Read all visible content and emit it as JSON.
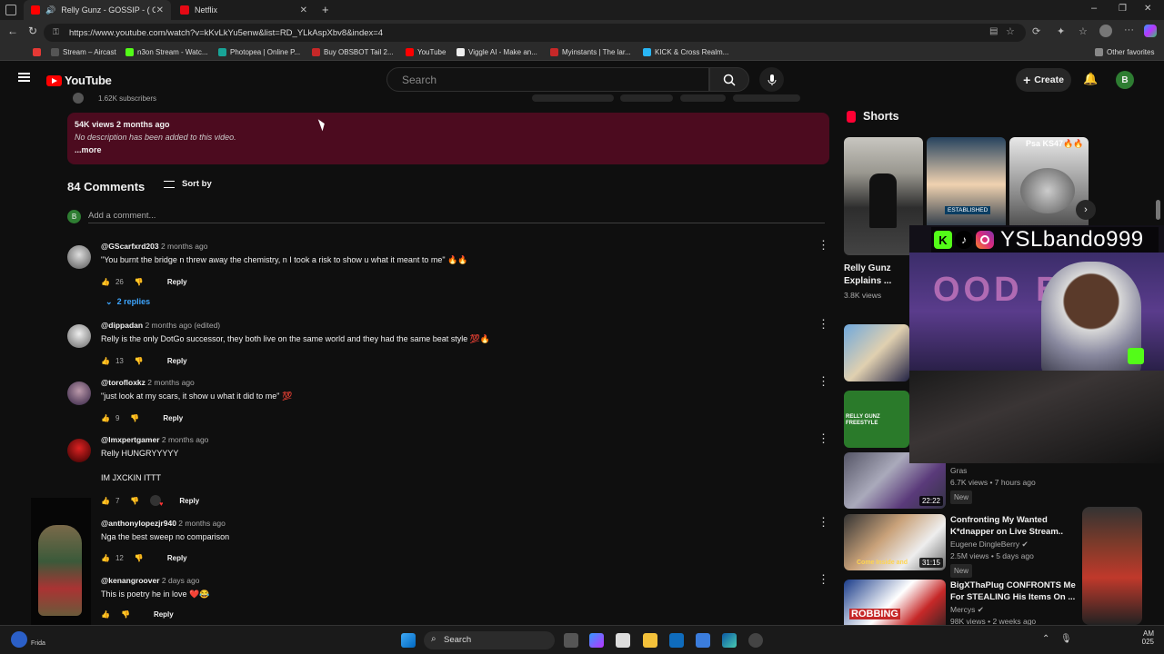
{
  "browser": {
    "tabs": [
      {
        "title": "Relly Gunz - GOSSIP - ( Offic"
      },
      {
        "title": "Netflix"
      }
    ],
    "url": "https://www.youtube.com/watch?v=kKvLkYu5enw&list=RD_YLkAspXbv8&index=4",
    "bookmarks": [
      "Stream – Aircast",
      "n3on Stream - Watc...",
      "Photopea | Online P...",
      "Buy OBSBOT Tail 2...",
      "YouTube",
      "Viggle AI - Make an...",
      "Myinstants | The lar...",
      "KICK & Cross Realm..."
    ],
    "other_favorites": "Other favorites"
  },
  "youtube": {
    "logo": "YouTube",
    "search_placeholder": "Search",
    "create_label": "Create",
    "avatar_letter": "B"
  },
  "channel_strip": {
    "subscribers": "1.62K subscribers"
  },
  "description": {
    "stats": "54K views  2 months ago",
    "text": "No description has been added to this video.",
    "more": "...more"
  },
  "comments_header": {
    "count": "84 Comments",
    "sort": "Sort by",
    "add_placeholder": "Add a comment...",
    "add_avatar": "B"
  },
  "comments": [
    {
      "handle": "@GScarfxrd203",
      "time": "2 months ago",
      "text": "\"You burnt the bridge n threw away the chemistry, n I took a risk to show u what it meant to me\" 🔥🔥",
      "likes": "26",
      "reply": "Reply",
      "replies": "2 replies"
    },
    {
      "handle": "@dippadan",
      "time": "2 months ago (edited)",
      "text": "Relly is the only DotGo successor, they both live on the same world and they had the same  beat style 💯🔥",
      "likes": "13",
      "reply": "Reply"
    },
    {
      "handle": "@torofloxkz",
      "time": "2 months ago",
      "text": "\"just look at my scars,  it show u what it did to me\" 💯",
      "likes": "9",
      "reply": "Reply"
    },
    {
      "handle": "@lmxpertgamer",
      "time": "2 months ago",
      "text": "Relly HUNGRYYYYY",
      "text2": "IM JXCKIN ITTT",
      "likes": "7",
      "reply": "Reply"
    },
    {
      "handle": "@anthonylopezjr940",
      "time": "2 months ago",
      "text": "Nga the best sweep no comparison",
      "likes": "12",
      "reply": "Reply"
    },
    {
      "handle": "@kenangroover",
      "time": "2 days ago",
      "text": "This is poetry he in love ❤️😂",
      "likes": "",
      "reply": "Reply"
    }
  ],
  "sidebar": {
    "shorts_title": "Shorts",
    "shorts_card3_label": "Psa KS47🔥🔥",
    "shorts_card2_label": "ESTABLISHED",
    "short_title": "Relly Gunz Explains ...",
    "short_views": "3.8K views",
    "videos": [
      {
        "title": "",
        "channel": "Gras",
        "stats": "6.7K views • 7 hours ago",
        "badge": "New",
        "duration": "22:22"
      },
      {
        "title": "Confronting My Wanted K*dnapper on Live Stream..",
        "channel": "Eugene DingleBerry",
        "stats": "2.5M views • 5 days ago",
        "badge": "New",
        "duration": "31:15",
        "thumb_text": "Come Inside and"
      },
      {
        "title": "BigXThaPlug CONFRONTS Me For STEALING His Items On ...",
        "channel": "Mercys",
        "stats": "98K views • 2 weeks ago",
        "badge": "",
        "duration": "",
        "thumb_text": "ROBBING"
      }
    ],
    "thumb_freestyle": "RELLY GUNZ FREESTYLE"
  },
  "overlay": {
    "username": "YSLbando999",
    "backdrop_text": "OOD BBS"
  },
  "taskbar": {
    "search": "Search",
    "time": "AM",
    "date": "025",
    "weather": "Frida"
  },
  "colors": {
    "yt_red": "#ff0000",
    "desc_bg": "#4c0b1f",
    "link_blue": "#3ea6ff"
  }
}
